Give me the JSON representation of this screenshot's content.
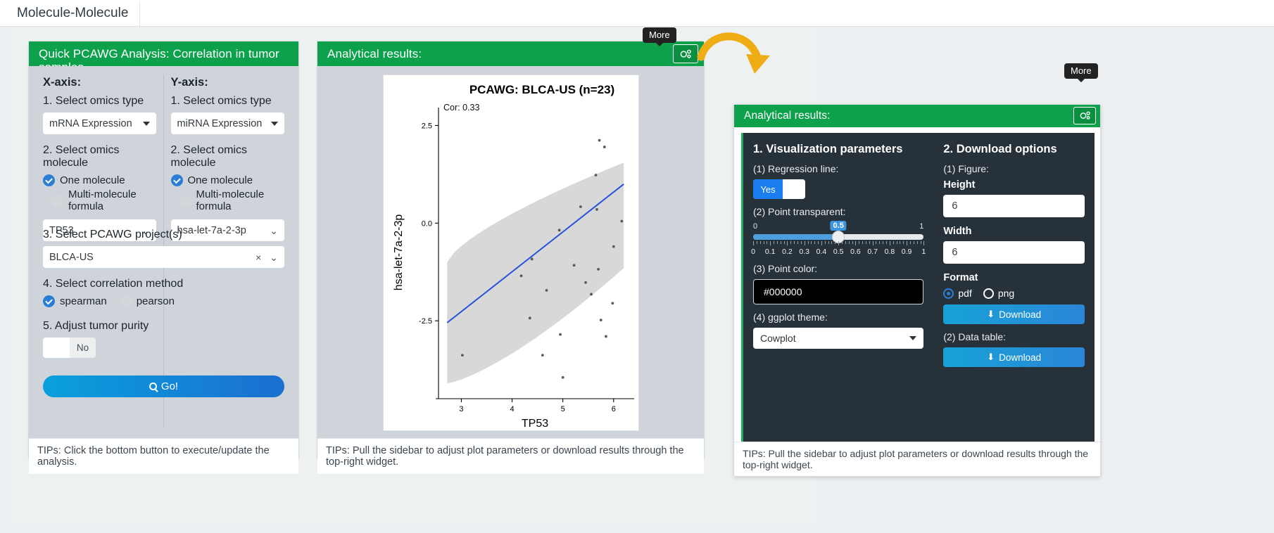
{
  "tab": {
    "label": "Molecule-Molecule"
  },
  "left_panel": {
    "title": "Quick PCAWG Analysis: Correlation in tumor samples",
    "x_axis": {
      "heading": "X-axis:",
      "step1_label": "1. Select omics type",
      "omics_type": "mRNA Expression",
      "step2_label": "2. Select omics molecule",
      "radio_one": "One molecule",
      "radio_multi": "Multi-molecule formula",
      "molecule": "TP53"
    },
    "y_axis": {
      "heading": "Y-axis:",
      "step1_label": "1. Select omics type",
      "omics_type": "miRNA Expression",
      "step2_label": "2. Select omics molecule",
      "radio_one": "One molecule",
      "radio_multi": "Multi-molecule formula",
      "molecule": "hsa-let-7a-2-3p"
    },
    "step3_label": "3. Select PCAWG project(s)",
    "project": "BLCA-US",
    "step4_label": "4. Select correlation method",
    "method_spearman": "spearman",
    "method_pearson": "pearson",
    "step5_label": "5. Adjust tumor purity",
    "purity_toggle": "No",
    "go_button": "Go!",
    "tips": "TIPs: Click the bottom button to execute/update the analysis."
  },
  "middle_panel": {
    "title": "Analytical results:",
    "gear_icon": "gear-icon",
    "more_tooltip": "More",
    "tips": "TIPs: Pull the sidebar to adjust plot parameters or download results through the top-right widget."
  },
  "chart_data": {
    "type": "scatter",
    "title": "PCAWG: BLCA-US (n=23)",
    "annotation": "Cor: 0.33",
    "xlabel": "TP53",
    "ylabel": "hsa-let-7a-2-3p",
    "xticks": [
      3,
      4,
      5,
      6
    ],
    "yticks": [
      -2.5,
      0.0,
      2.5
    ],
    "xlim": [
      2.55,
      6.35
    ],
    "ylim": [
      -4.35,
      2.85
    ],
    "grid": false,
    "legend": false,
    "regression_line": {
      "color": "#2953d8",
      "x": [
        2.72,
        6.2
      ],
      "y": [
        -2.55,
        1.0
      ]
    },
    "confidence_band": {
      "color": "#d8d8d8",
      "lower": [
        -4.1,
        -1.15
      ],
      "upper": [
        -1.0,
        1.55
      ]
    },
    "points": [
      {
        "x": 5.72,
        "y": 2.12
      },
      {
        "x": 5.82,
        "y": 1.95
      },
      {
        "x": 5.65,
        "y": 1.23
      },
      {
        "x": 5.35,
        "y": 0.42
      },
      {
        "x": 5.67,
        "y": 0.35
      },
      {
        "x": 6.16,
        "y": 0.05
      },
      {
        "x": 4.93,
        "y": -0.18
      },
      {
        "x": 4.39,
        "y": -0.92
      },
      {
        "x": 5.22,
        "y": -1.08
      },
      {
        "x": 5.7,
        "y": -1.18
      },
      {
        "x": 5.45,
        "y": -1.52
      },
      {
        "x": 4.68,
        "y": -1.72
      },
      {
        "x": 5.56,
        "y": -1.82
      },
      {
        "x": 5.98,
        "y": -2.05
      },
      {
        "x": 4.35,
        "y": -2.43
      },
      {
        "x": 5.75,
        "y": -2.48
      },
      {
        "x": 4.95,
        "y": -2.85
      },
      {
        "x": 3.02,
        "y": -3.38
      },
      {
        "x": 4.6,
        "y": -3.38
      },
      {
        "x": 5.0,
        "y": -3.95
      },
      {
        "x": 5.85,
        "y": -2.9
      },
      {
        "x": 4.18,
        "y": -1.35
      },
      {
        "x": 6.0,
        "y": -0.6
      }
    ]
  },
  "right_panel": {
    "title": "Analytical results:",
    "gear_icon": "gear-icon",
    "more_tooltip": "More",
    "viz": {
      "heading": "1. Visualization parameters",
      "regression_label": "(1) Regression line:",
      "regression_value": "Yes",
      "transparent_label": "(2) Point transparent:",
      "slider_min": "0",
      "slider_max": "1",
      "slider_value": "0.5",
      "slider_ticks": [
        "0",
        "0.1",
        "0.2",
        "0.3",
        "0.4",
        "0.5",
        "0.6",
        "0.7",
        "0.8",
        "0.9",
        "1"
      ],
      "color_label": "(3) Point color:",
      "color_value": "#000000",
      "theme_label": "(4) ggplot theme:",
      "theme_value": "Cowplot"
    },
    "download": {
      "heading": "2. Download options",
      "figure_label": "(1) Figure:",
      "height_label": "Height",
      "height_value": "6",
      "width_label": "Width",
      "width_value": "6",
      "format_label": "Format",
      "format_pdf": "pdf",
      "format_png": "png",
      "download_figure": "Download",
      "datatable_label": "(2) Data table:",
      "download_table": "Download"
    },
    "tips": "TIPs: Pull the sidebar to adjust plot parameters or download results through the top-right widget."
  },
  "colors": {
    "green_header": "#0ca14a",
    "panel_body": "#ced4da",
    "dark_panel": "#27313a",
    "accent_blue": "#2a7fd4",
    "arrow": "#eead14"
  }
}
